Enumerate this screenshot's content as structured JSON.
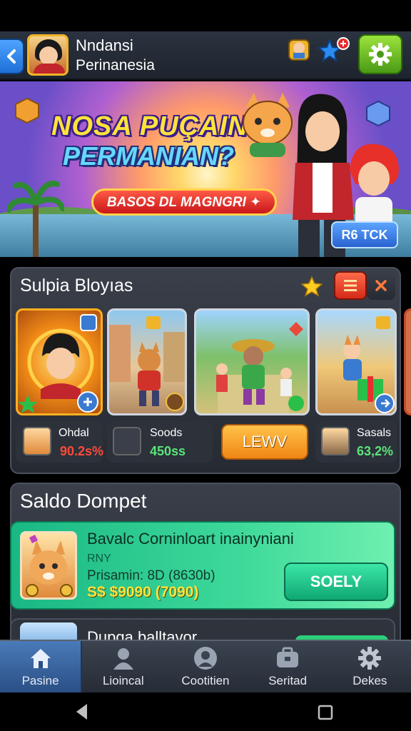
{
  "header": {
    "user_name": "Nndansi",
    "user_subtitle": "Perinanesia"
  },
  "banner": {
    "title_line1": "NOSA PUÇAIN",
    "title_line2": "PERMANIAN?",
    "cta_label": "BASOS DL MAGNGRI ✦",
    "side_button_label": "R6 TCK"
  },
  "popular": {
    "title": "Sulpia Bloyıas",
    "games": [
      {
        "name": "Ohdal",
        "value": "90.2s%"
      },
      {
        "name": "Soods",
        "value": "450ss"
      },
      {
        "name": "Sasals",
        "value": "63,2%"
      }
    ],
    "action_label": "LEWV"
  },
  "wallet": {
    "title": "Saldo Dompet",
    "card": {
      "heading": "Bavalc Corninloart inainyniani",
      "code": "RNY",
      "promo": "Prisamin: 8D (8630b)",
      "amount": "S$ $9090 (7090)",
      "button_label": "SOELY"
    },
    "next_item_label": "Dupga balltavor"
  },
  "bottom_nav": {
    "items": [
      {
        "label": "Pasine",
        "icon": "home-icon"
      },
      {
        "label": "Lioincal",
        "icon": "user-icon"
      },
      {
        "label": "Cootitien",
        "icon": "profile-circle-icon"
      },
      {
        "label": "Seritad",
        "icon": "briefcase-icon"
      },
      {
        "label": "Dekes",
        "icon": "gear-icon"
      }
    ],
    "active_index": 0
  },
  "colors": {
    "accent_green": "#4a9a16",
    "accent_blue": "#2a4f86",
    "wallet_green": "#19b884",
    "alert_red": "#ff4b3a"
  }
}
